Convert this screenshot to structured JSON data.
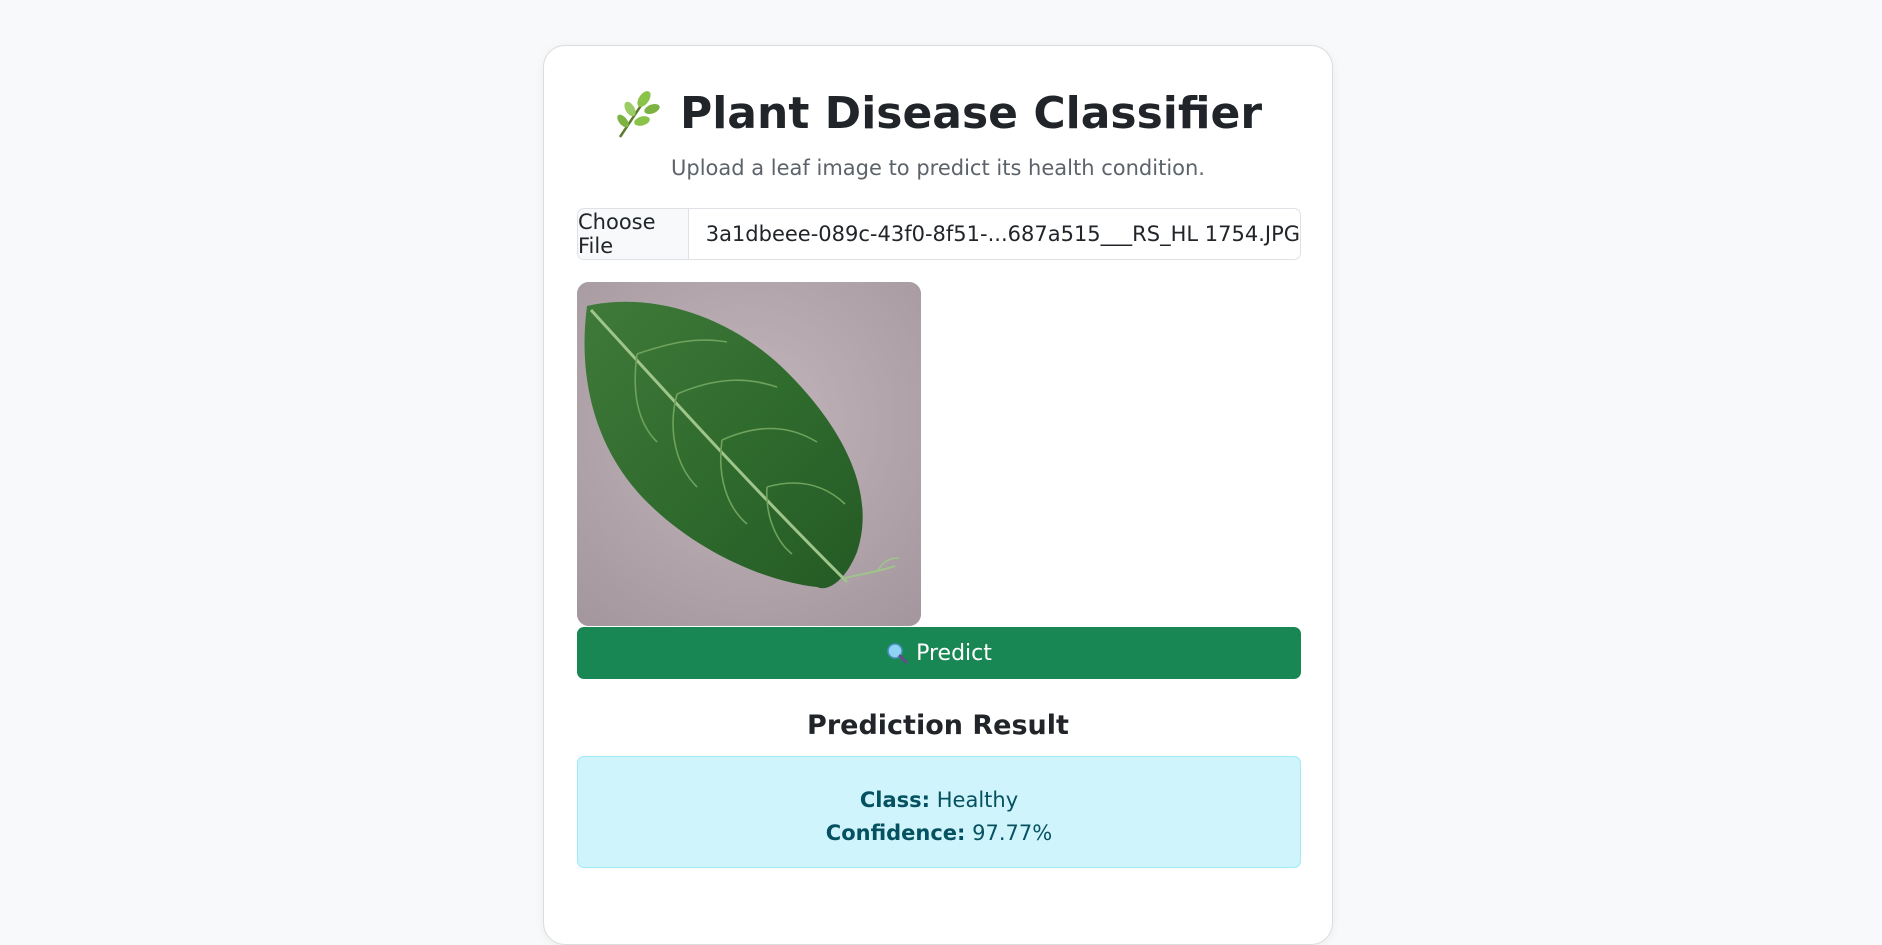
{
  "header": {
    "icon": "herb-icon",
    "title": "Plant Disease Classifier",
    "subtitle": "Upload a leaf image to predict its health condition."
  },
  "upload": {
    "button_label": "Choose File",
    "file_name": "3a1dbeee-089c-43f0-8f51-...687a515___RS_HL 1754.JPG"
  },
  "preview": {
    "image": "leaf-photo"
  },
  "predict": {
    "icon": "magnifier-icon",
    "label": "Predict"
  },
  "result": {
    "heading": "Prediction Result",
    "class_label": "Class:",
    "class_value": "Healthy",
    "confidence_label": "Confidence:",
    "confidence_value": "97.77%"
  },
  "colors": {
    "primary_green": "#198754",
    "info_bg": "#cff4fc",
    "info_text": "#055160",
    "page_bg": "#f8f9fa"
  }
}
